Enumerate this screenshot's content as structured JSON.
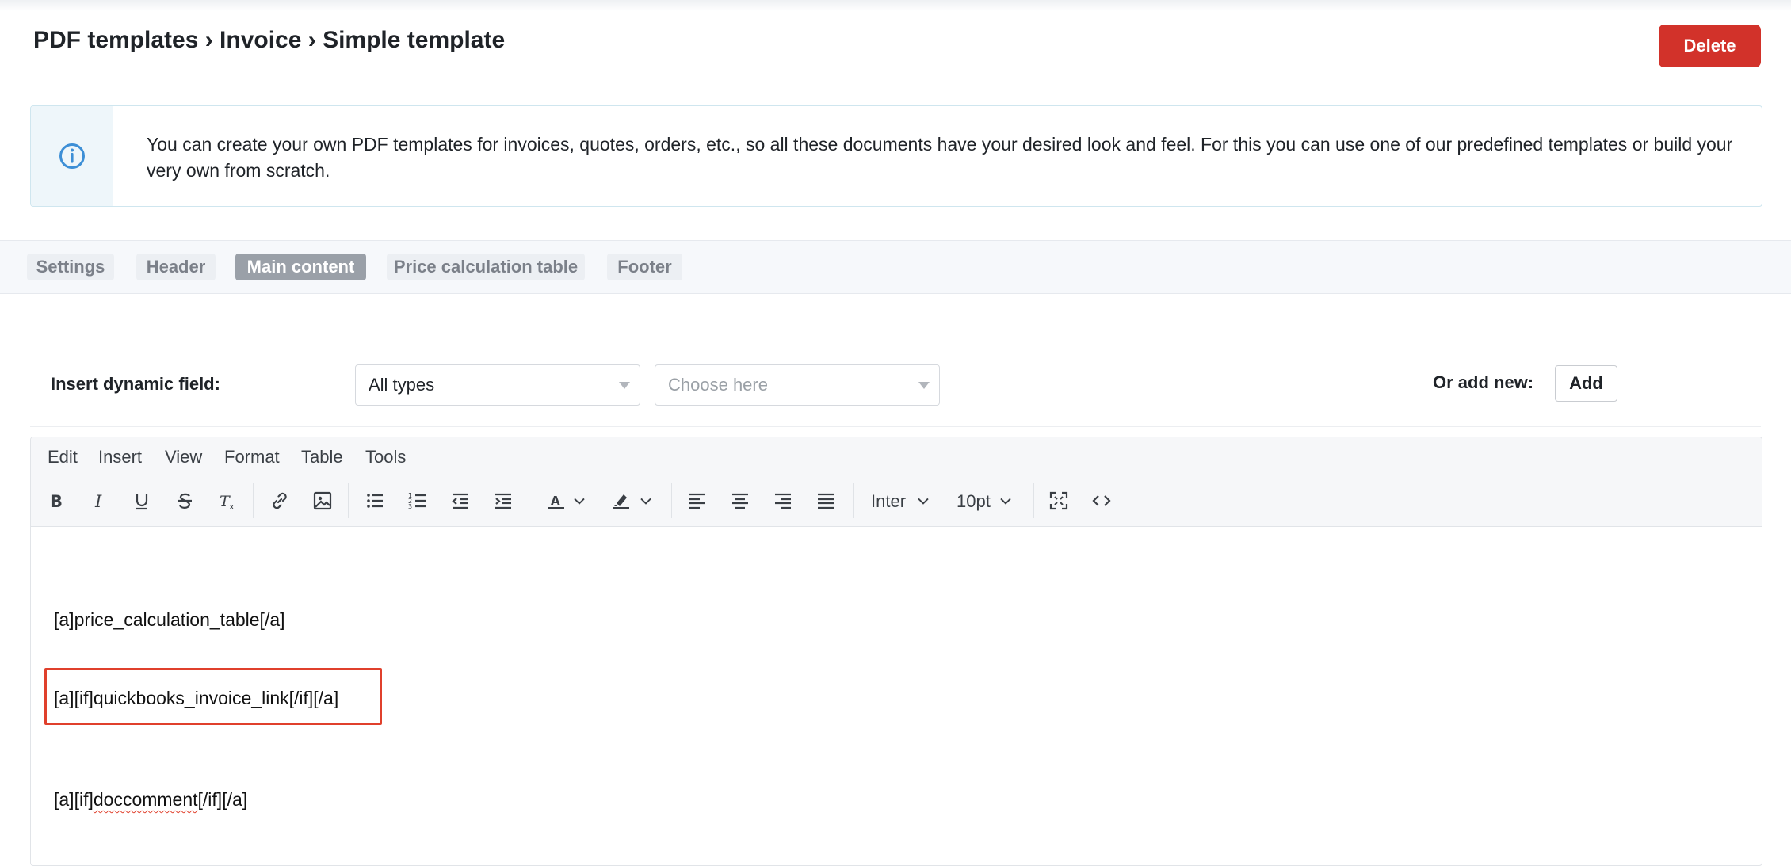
{
  "header": {
    "breadcrumb": "PDF templates › Invoice › Simple template",
    "delete_label": "Delete"
  },
  "info": {
    "icon": "info-circle-icon",
    "text": "You can create your own PDF templates for invoices, quotes, orders, etc., so all these documents have your desired look and feel. For this you can use one of our predefined templates or build your very own from scratch."
  },
  "tabs": [
    {
      "label": "Settings",
      "active": false
    },
    {
      "label": "Header",
      "active": false
    },
    {
      "label": "Main content",
      "active": true
    },
    {
      "label": "Price calculation table",
      "active": false
    },
    {
      "label": "Footer",
      "active": false
    }
  ],
  "dynamic_field": {
    "label": "Insert dynamic field:",
    "type_select_value": "All types",
    "field_select_placeholder": "Choose here",
    "or_add_label": "Or add new:",
    "add_label": "Add"
  },
  "editor": {
    "menu": [
      "Edit",
      "Insert",
      "View",
      "Format",
      "Table",
      "Tools"
    ],
    "font_family": "Inter",
    "font_size": "10pt",
    "lines": [
      "[a]price_calculation_table[/a]",
      "[a][if]quickbooks_invoice_link[/if][/a]"
    ],
    "last_line": {
      "prefix": "[a][if]",
      "misspelled": "doccomment",
      "suffix": "[/if][/a]"
    }
  },
  "colors": {
    "delete_button": "#d2322a",
    "info_icon": "#3d8fd6",
    "active_tab": "#9aa0a8",
    "highlight_box": "#e0402c"
  }
}
